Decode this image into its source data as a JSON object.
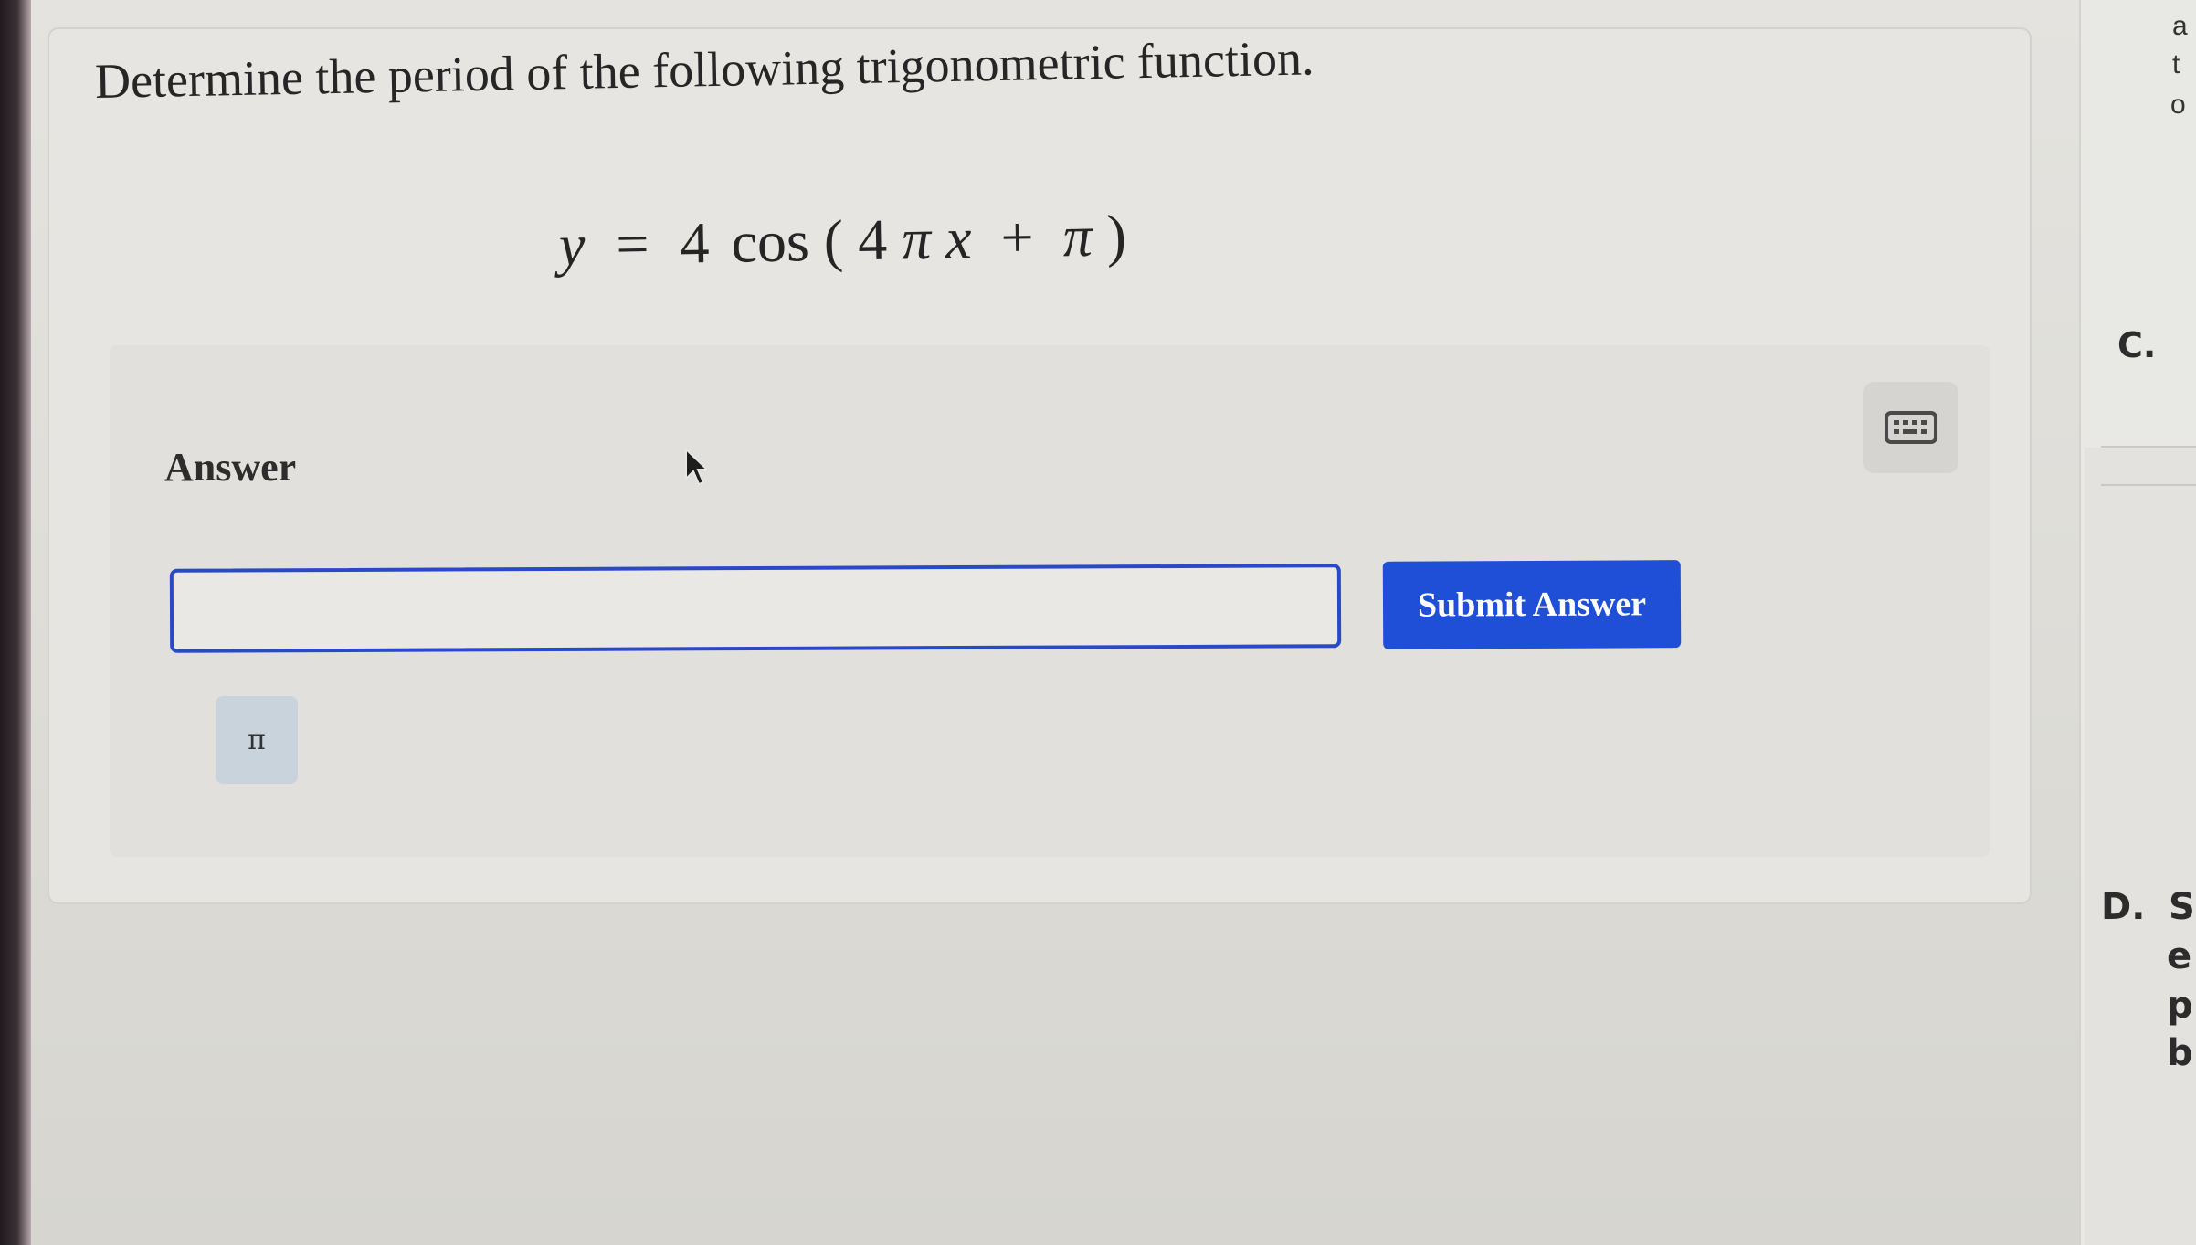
{
  "question": {
    "prompt": "Determine the period of the following trigonometric function.",
    "equation": {
      "lhs": "y",
      "equals": "=",
      "coef": "4",
      "func": "cos",
      "open": "(",
      "inner_coef": "4",
      "pi": "π",
      "var": "x",
      "plus": "+",
      "const": "π",
      "close": ")"
    }
  },
  "answer": {
    "label": "Answer",
    "input_value": "",
    "submit_label": "Submit Answer",
    "pi_button_label": "π",
    "keyboard_icon": "keyboard-icon"
  },
  "side_panel": {
    "top_fragments": [
      "a",
      "t",
      "o"
    ],
    "option_c_label": "C.",
    "option_d_label": "D.",
    "option_d_fragment": "S",
    "option_d_lines": [
      "e",
      "p",
      "b"
    ]
  },
  "colors": {
    "accent": "#1f4fd6",
    "input_border": "#2a49c8",
    "pi_button_bg": "#c9d3dc"
  }
}
